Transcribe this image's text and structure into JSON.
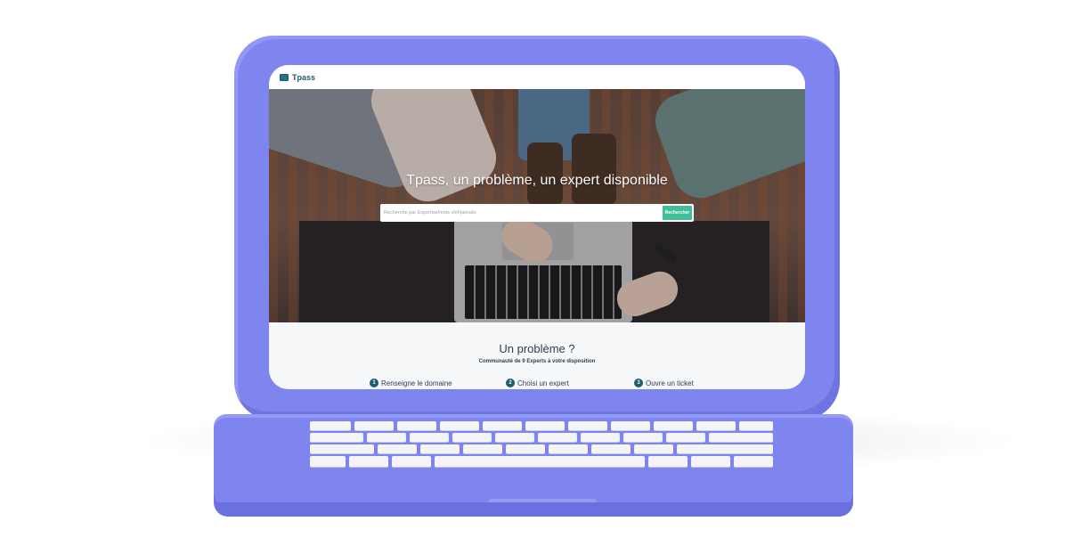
{
  "brand": {
    "name": "Tpass"
  },
  "hero": {
    "title": "Tpass, un problème, un expert disponible",
    "search_placeholder": "Recherche par Expertise/mots clef/pseudo",
    "search_button": "Rechercher"
  },
  "section": {
    "title": "Un problème ?",
    "subtitle": "Communauté de 9 Experts à votre disposition",
    "steps": [
      {
        "number": "1",
        "label": "Renseigne le domaine"
      },
      {
        "number": "2",
        "label": "Choisi un expert"
      },
      {
        "number": "3",
        "label": "Ouvre un ticket"
      }
    ]
  },
  "colors": {
    "laptop_body": "#7f85ee",
    "brand_teal": "#1f5c6e",
    "search_button": "#3fbf98"
  }
}
